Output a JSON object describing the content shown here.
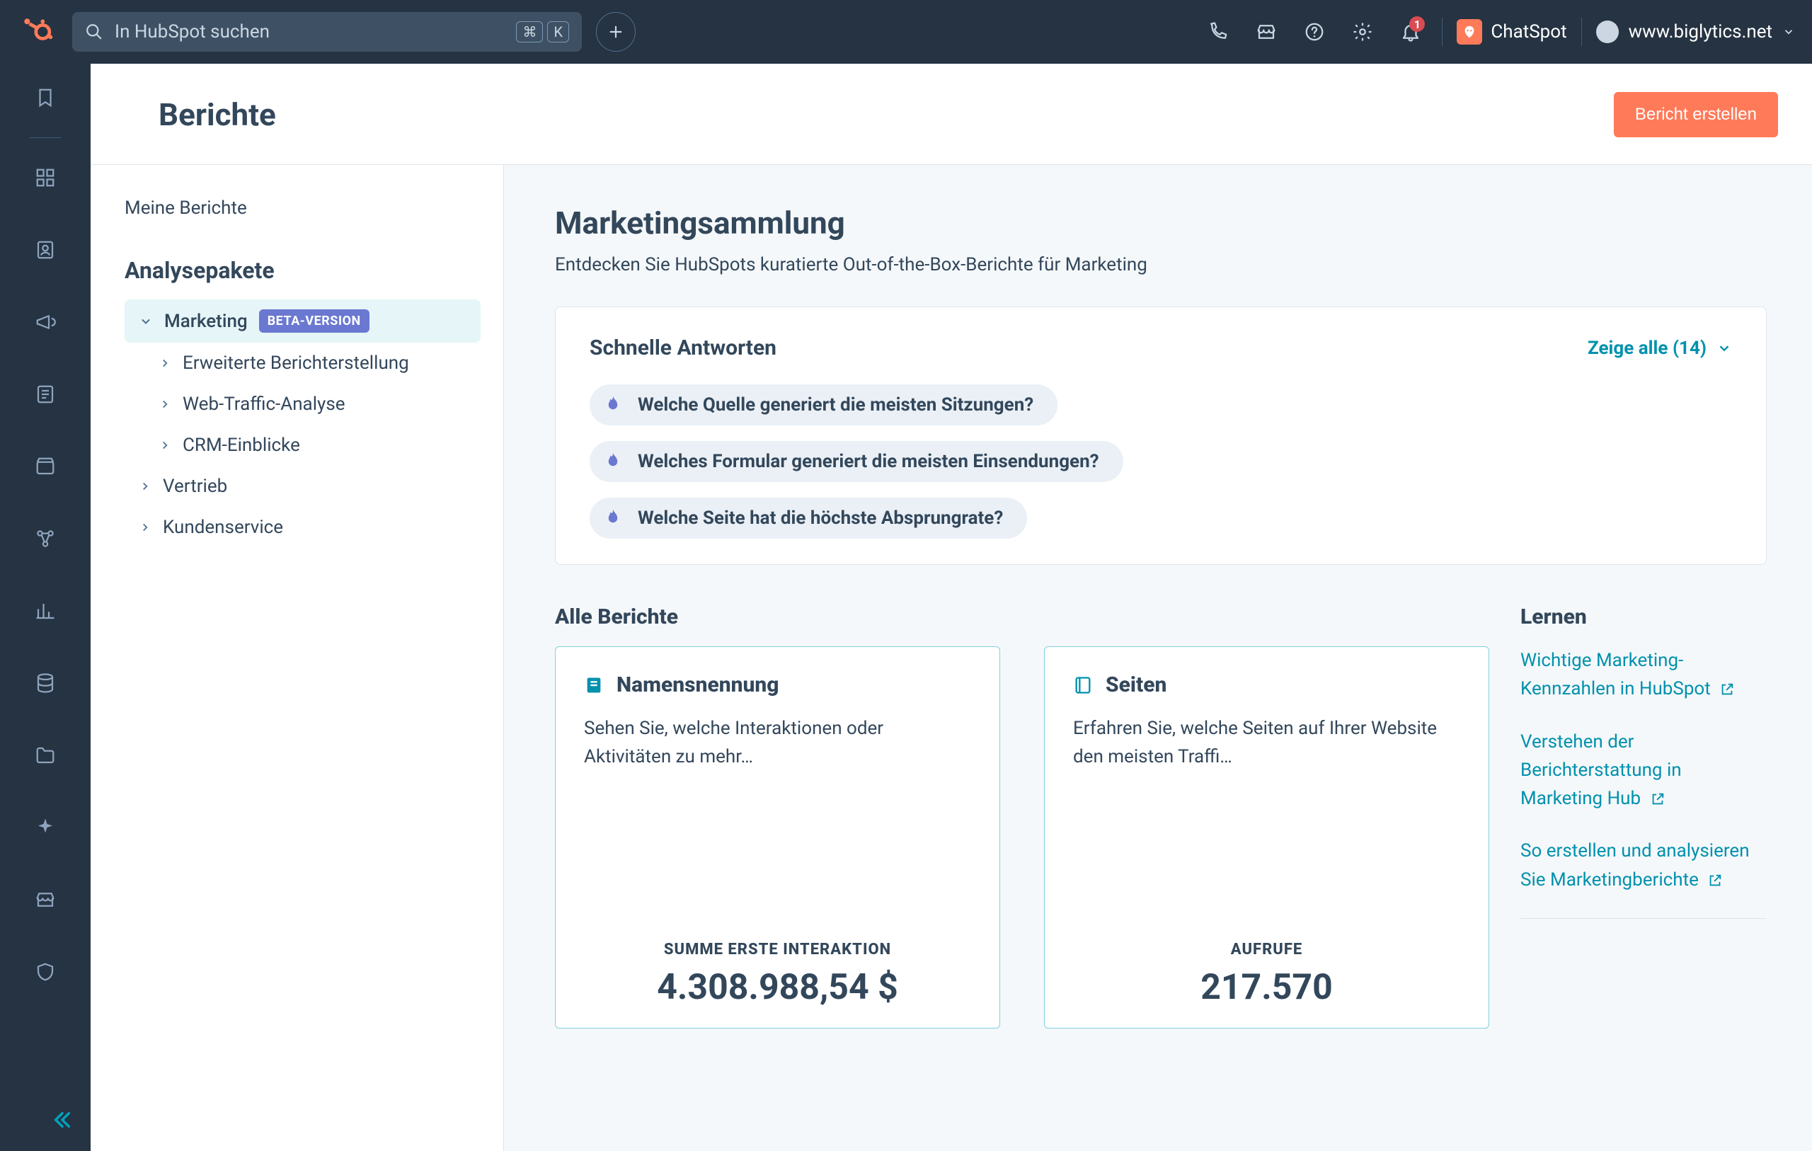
{
  "colors": {
    "accent": "#ff7a59",
    "link": "#0091ae",
    "sidebar": "#253342"
  },
  "topnav": {
    "search_placeholder": "In HubSpot suchen",
    "kbd1": "⌘",
    "kbd2": "K",
    "notifications_badge": "1",
    "chatspot_label": "ChatSpot",
    "account_label": "www.biglytics.net"
  },
  "page": {
    "title": "Berichte",
    "create_button": "Bericht erstellen"
  },
  "sidebar": {
    "my_reports": "Meine Berichte",
    "section": "Analysepakete",
    "items": [
      {
        "label": "Marketing",
        "beta": "BETA-VERSION",
        "selected": true,
        "children": [
          {
            "label": "Erweiterte Berichterstellung"
          },
          {
            "label": "Web-Traffic-Analyse"
          },
          {
            "label": "CRM-Einblicke"
          }
        ]
      },
      {
        "label": "Vertrieb"
      },
      {
        "label": "Kundenservice"
      }
    ]
  },
  "content": {
    "title": "Marketingsammlung",
    "subtitle": "Entdecken Sie HubSpots kuratierte Out-of-the-Box-Berichte für Marketing",
    "quick": {
      "title": "Schnelle Antworten",
      "show_all": "Zeige alle (14)",
      "chips": [
        "Welche Quelle generiert die meisten Sitzungen?",
        "Welches Formular generiert die meisten Einsendungen?",
        "Welche Seite hat die höchste Absprungrate?"
      ]
    },
    "all_reports_heading": "Alle Berichte",
    "report_cards": [
      {
        "title": "Namensnennung",
        "desc": "Sehen Sie, welche Interaktionen oder Aktivitäten zu mehr…",
        "metric_label": "SUMME ERSTE INTERAKTION",
        "metric_value": "4.308.988,54 $"
      },
      {
        "title": "Seiten",
        "desc": "Erfahren Sie, welche Seiten auf Ihrer Website den meisten Traffi…",
        "metric_label": "AUFRUFE",
        "metric_value": "217.570"
      }
    ],
    "learn": {
      "heading": "Lernen",
      "links": [
        "Wichtige Marketing-Kennzahlen in HubSpot",
        "Verstehen der Berichterstattung in Marketing Hub",
        "So erstellen und analysieren Sie Marketingberichte"
      ]
    }
  }
}
